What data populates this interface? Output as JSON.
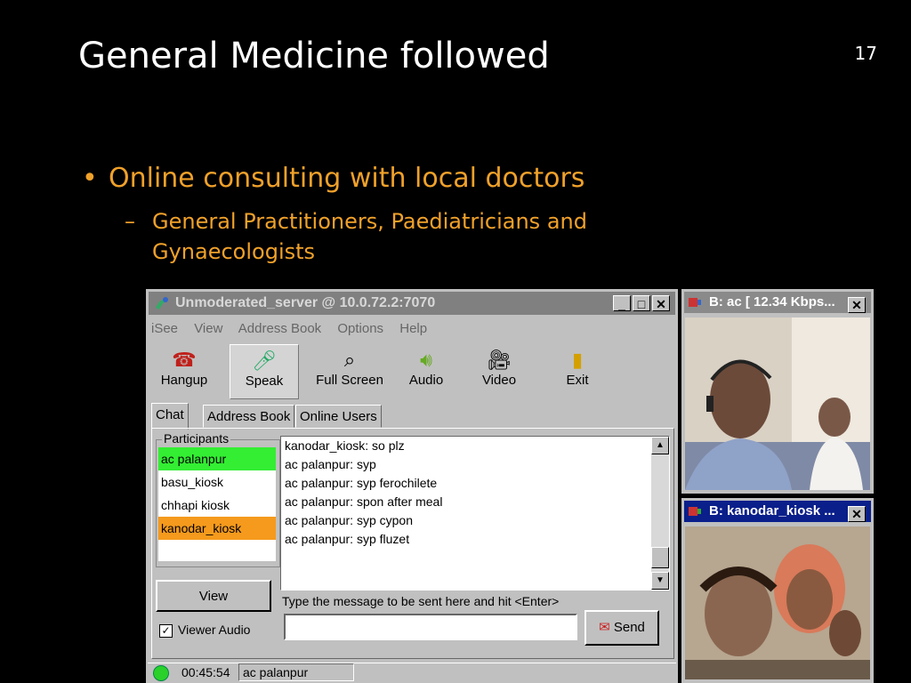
{
  "slide": {
    "title": "General Medicine followed",
    "number": "17",
    "bullet": "Online consulting with local doctors",
    "sub_bullet": "General Practitioners, Paediatricians and Gynaecologists"
  },
  "app": {
    "title": "Unmoderated_server @ 10.0.72.2:7070",
    "menu": [
      "iSee",
      "View",
      "Address Book",
      "Options",
      "Help"
    ],
    "toolbar": [
      "Hangup",
      "Speak",
      "Full Screen",
      "Audio",
      "Video",
      "Exit"
    ],
    "tabs": [
      "Chat",
      "Address Book",
      "Online Users"
    ],
    "participants_label": "Participants",
    "participants": [
      "ac palanpur",
      "basu_kiosk",
      "chhapi kiosk",
      "kanodar_kiosk"
    ],
    "chat_lines": [
      "kanodar_kiosk: so plz",
      "ac palanpur: syp",
      "ac palanpur: syp ferochilete",
      "ac palanpur: spon after meal",
      "ac palanpur: syp cypon",
      "ac palanpur: syp fluzet"
    ],
    "view_button": "View",
    "viewer_audio": "Viewer Audio",
    "hint": "Type the message to be sent here and hit <Enter>",
    "message_value": "",
    "send_button": "Send",
    "status_time": "00:45:54",
    "status_user": "ac palanpur"
  },
  "video1": {
    "title": "B: ac [ 12.34 Kbps..."
  },
  "video2": {
    "title": "B: kanodar_kiosk ..."
  },
  "colors": {
    "accent": "#f0a12a",
    "highlight_green": "#33ee33",
    "highlight_orange": "#f59a1c"
  }
}
